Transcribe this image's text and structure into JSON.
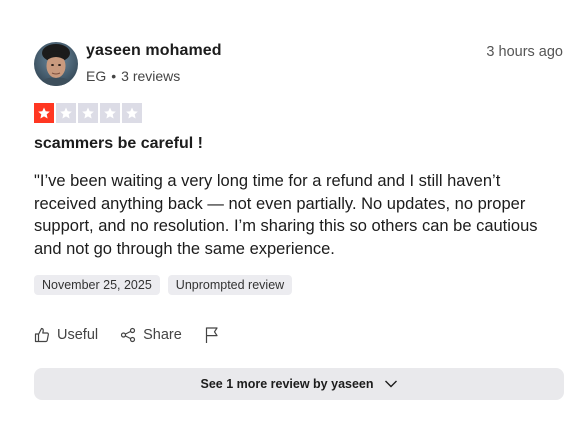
{
  "reviewer": {
    "name": "yaseen mohamed",
    "country": "EG",
    "separator": "•",
    "review_count": "3 reviews",
    "avatar_icon": "profile-photo"
  },
  "time_ago": "3 hours ago",
  "rating": {
    "value": 1,
    "max": 5,
    "filled_color": "#ff3722",
    "empty_color": "#dcdce6"
  },
  "review": {
    "title": "scammers be careful !",
    "body": "\"I’ve been waiting a very long time for a refund and I still haven’t received anything back — not even partially. No updates, no proper support, and no resolution. I’m sharing this so others can be cautious and not go through the same experience."
  },
  "tags": {
    "date": "November 25, 2025",
    "type": "Unprompted review"
  },
  "actions": {
    "useful_label": "Useful",
    "useful_icon": "thumbs-up-icon",
    "share_label": "Share",
    "share_icon": "share-icon",
    "report_icon": "flag-icon"
  },
  "more_reviews": {
    "label": "See 1 more review by yaseen",
    "icon": "chevron-down-icon"
  }
}
